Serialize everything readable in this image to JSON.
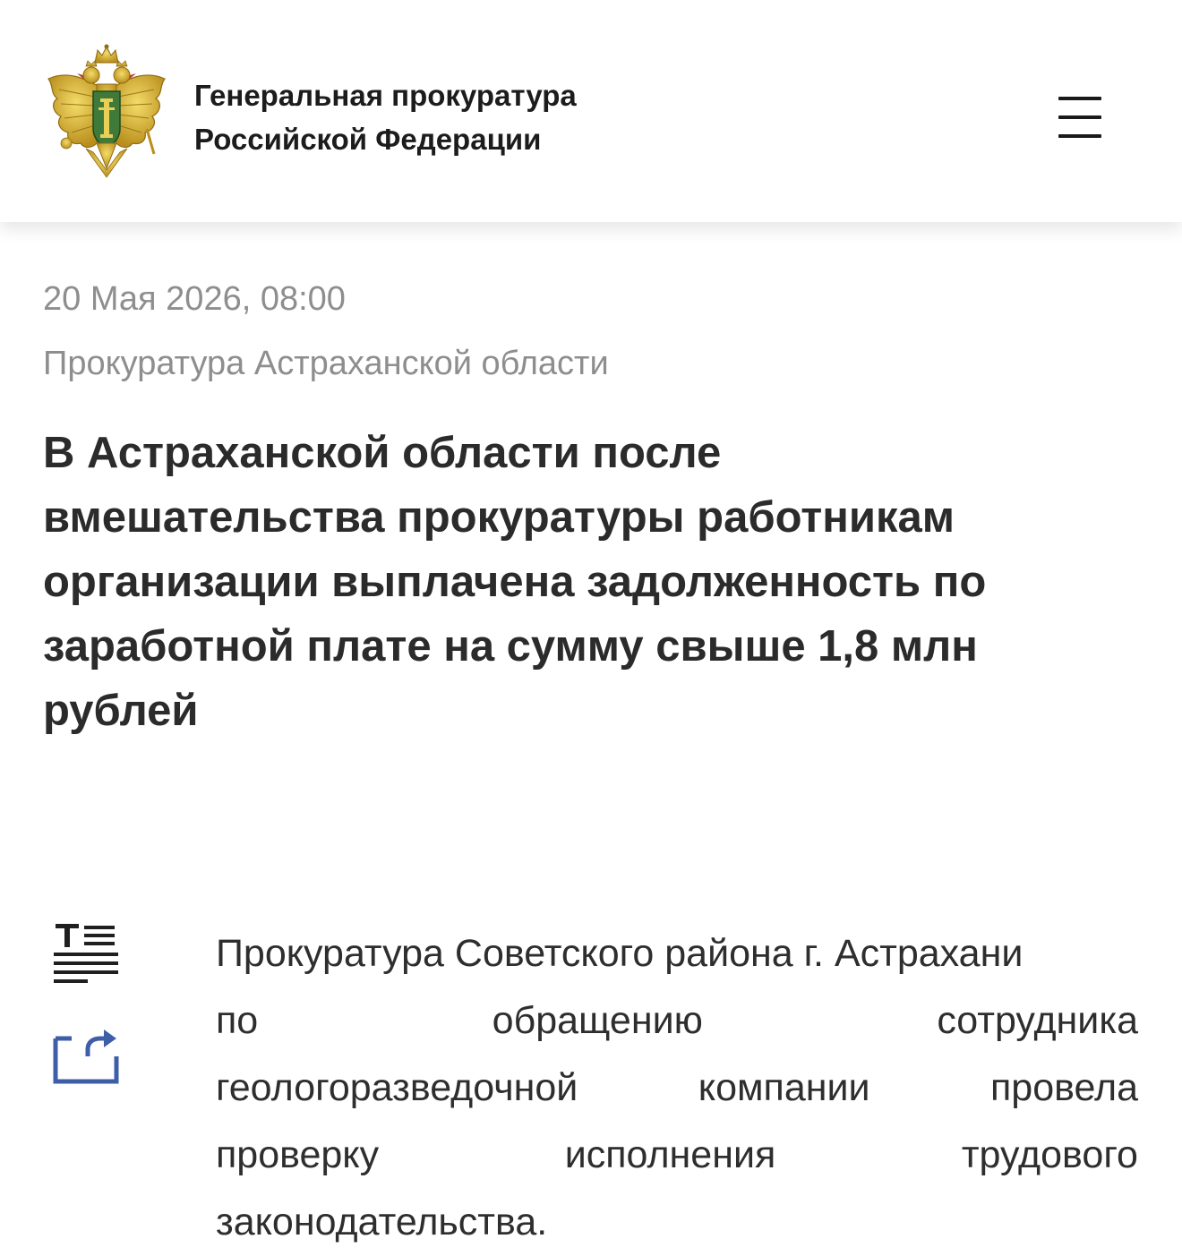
{
  "header": {
    "org_name_line1": "Генеральная прокуратура",
    "org_name_line2": "Российской Федерации",
    "emblem_icon": "double-headed-eagle-emblem-icon",
    "menu_icon": "hamburger-menu-icon"
  },
  "article": {
    "date": "20 Мая 2026, 08:00",
    "source": "Прокуратура Астраханской области",
    "title_lines": [
      "В Астраханской области после",
      "вмешательства прокуратуры работникам",
      "организации выплачена задолженность по",
      "заработной плате на сумму свыше 1,8 млн",
      "рублей"
    ],
    "body_lines": [
      [
        "Прокуратура Советского района г. Астрахани"
      ],
      [
        "по",
        "обращению",
        "сотрудника"
      ],
      [
        "геологоразведочной",
        "компании",
        "провела"
      ],
      [
        "проверку",
        "исполнения",
        "трудового"
      ],
      [
        "законодательства."
      ]
    ]
  },
  "tools": {
    "text_size_icon": "text-size-icon",
    "share_icon": "share-icon"
  },
  "colors": {
    "meta_text": "#8e8e8e",
    "title_text": "#2b2b2b",
    "body_text": "#2e2e2e",
    "tool_icon": "#3f5ea8",
    "emblem_gold": "#c9a227",
    "emblem_green": "#3f7a3a"
  }
}
